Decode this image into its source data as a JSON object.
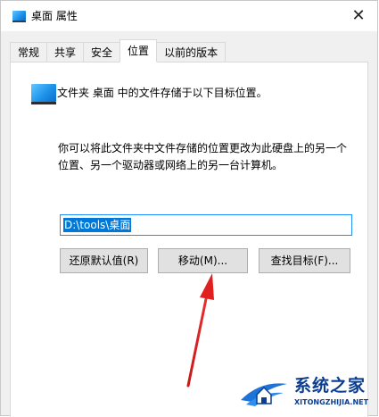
{
  "window": {
    "title": "桌面 属性",
    "close_glyph": "✕"
  },
  "tabs": [
    {
      "label": "常规",
      "active": false
    },
    {
      "label": "共享",
      "active": false
    },
    {
      "label": "安全",
      "active": false
    },
    {
      "label": "位置",
      "active": true
    },
    {
      "label": "以前的版本",
      "active": false
    }
  ],
  "location": {
    "description": "文件夹 桌面 中的文件存储于以下目标位置。",
    "info_line1": "你可以将此文件夹中文件存储的位置更改为此硬盘上的另一个",
    "info_line2": "位置、另一个驱动器或网络上的另一台计算机。",
    "path_value": "D:\\tools\\桌面",
    "buttons": {
      "restore": "还原默认值(R)",
      "move": "移动(M)...",
      "find": "查找目标(F)..."
    }
  },
  "watermark": {
    "name": "系统之家",
    "domain": "XITONGZHIJIA.NET"
  },
  "colors": {
    "accent": "#0078d7",
    "arrow": "#e02020",
    "watermark": "#0b3d91"
  },
  "icons": {
    "title": "folder-desktop-icon",
    "close": "close-icon",
    "folder": "folder-desktop-icon",
    "annotation": "arrow-annotation"
  }
}
